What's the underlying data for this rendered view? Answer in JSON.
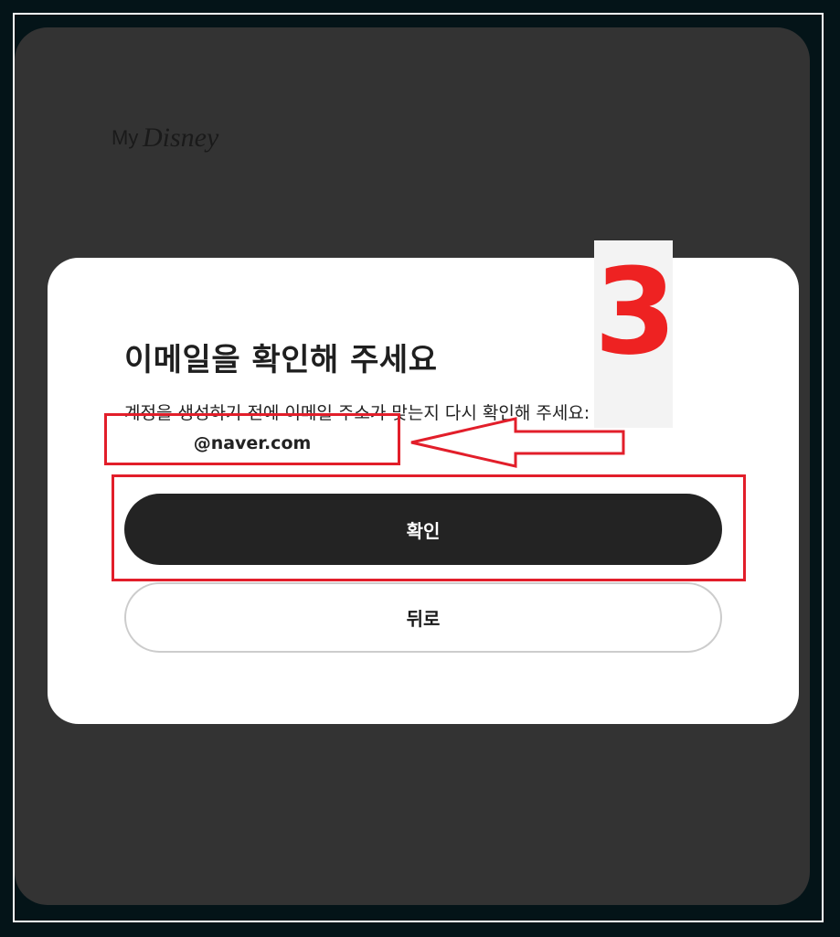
{
  "brand": {
    "logo_prefix": "My",
    "logo_word": "Disney"
  },
  "dialog": {
    "title": "이메일을 확인해 주세요",
    "description": "계정을 생성하기 전에 이메일 주소가 맞는지 다시 확인해 주세요:",
    "email": "@naver.com",
    "confirm_label": "확인",
    "back_label": "뒤로"
  },
  "annotation": {
    "step_number": "3"
  },
  "colors": {
    "background": "#333333",
    "modal": "#ffffff",
    "primary_button": "#232323",
    "annotation_red": "#e21e2a"
  }
}
